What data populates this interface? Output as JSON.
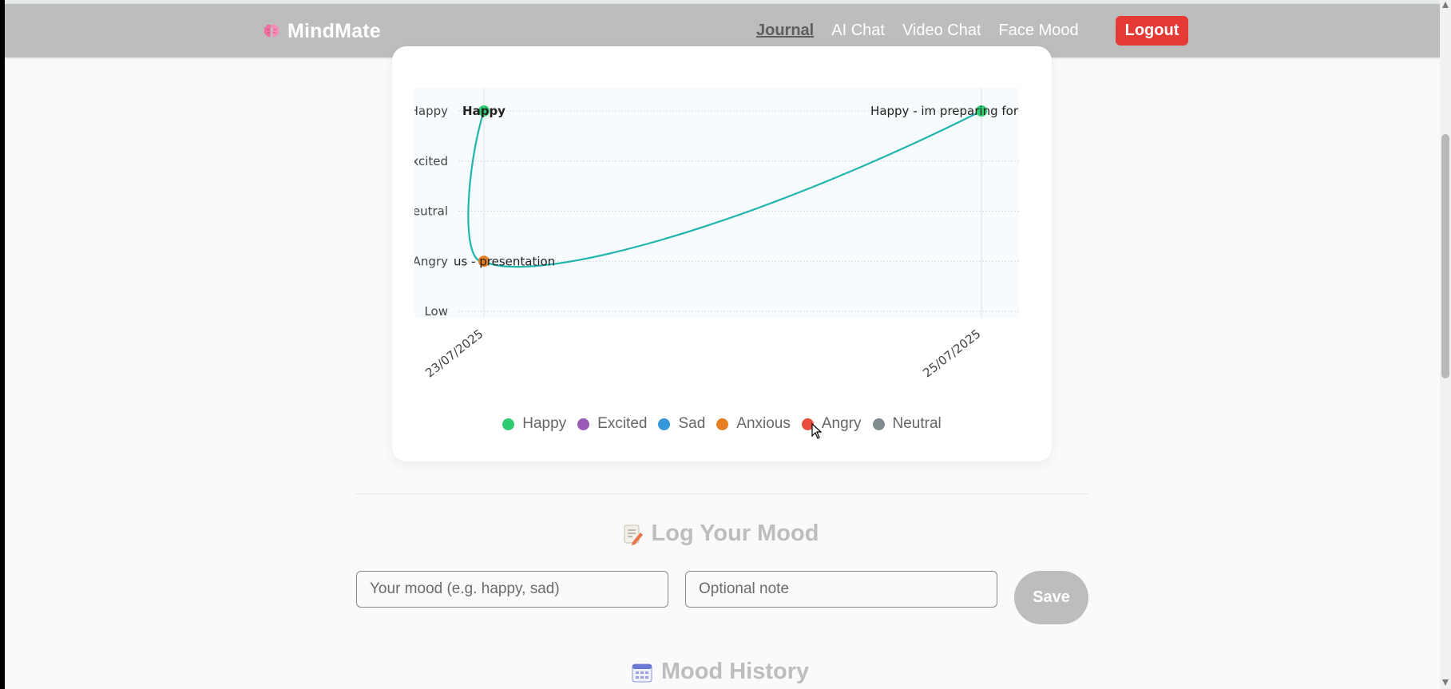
{
  "app": {
    "name": "MindMate",
    "icon": "brain-icon"
  },
  "nav": {
    "links": [
      {
        "label": "Journal",
        "active": true
      },
      {
        "label": "AI Chat",
        "active": false
      },
      {
        "label": "Video Chat",
        "active": false
      },
      {
        "label": "Face Mood",
        "active": false
      }
    ],
    "logout_label": "Logout"
  },
  "colors": {
    "navbar": "#bdbdbd",
    "logout": "#e53935",
    "line": "#1fb5ad",
    "happy": "#2ecc71",
    "excited": "#9b59b6",
    "sad": "#3498db",
    "anxious": "#e67e22",
    "angry": "#e74c3c",
    "neutral": "#7f8c8d"
  },
  "chart_data": {
    "type": "line",
    "y_categories": [
      "Low",
      "Angry",
      "Neutral",
      "Excited",
      "Happy"
    ],
    "y_tick_labels": [
      "Low",
      "Angry",
      "eutral",
      "xcited",
      "Happy"
    ],
    "x_tick_labels": [
      "23/07/2025",
      "25/07/2025"
    ],
    "points": [
      {
        "x": "23/07/2025",
        "y": "Happy",
        "mood": "Happy",
        "label": "Happy"
      },
      {
        "x": "23/07/2025",
        "y": "Angry",
        "mood": "Anxious",
        "label": "us - presentation"
      },
      {
        "x": "25/07/2025",
        "y": "Happy",
        "mood": "Happy",
        "label": "Happy - im preparing for"
      }
    ],
    "legend": [
      {
        "label": "Happy",
        "color": "#2ecc71"
      },
      {
        "label": "Excited",
        "color": "#9b59b6"
      },
      {
        "label": "Sad",
        "color": "#3498db"
      },
      {
        "label": "Anxious",
        "color": "#e67e22"
      },
      {
        "label": "Angry",
        "color": "#e74c3c"
      },
      {
        "label": "Neutral",
        "color": "#7f8c8d"
      }
    ],
    "grid": true,
    "legend_position": "bottom"
  },
  "log_section": {
    "title": "Log Your Mood",
    "icon": "memo-icon",
    "mood_placeholder": "Your mood (e.g. happy, sad)",
    "note_placeholder": "Optional note",
    "save_label": "Save"
  },
  "history_section": {
    "title": "Mood History",
    "icon": "calendar-icon"
  }
}
